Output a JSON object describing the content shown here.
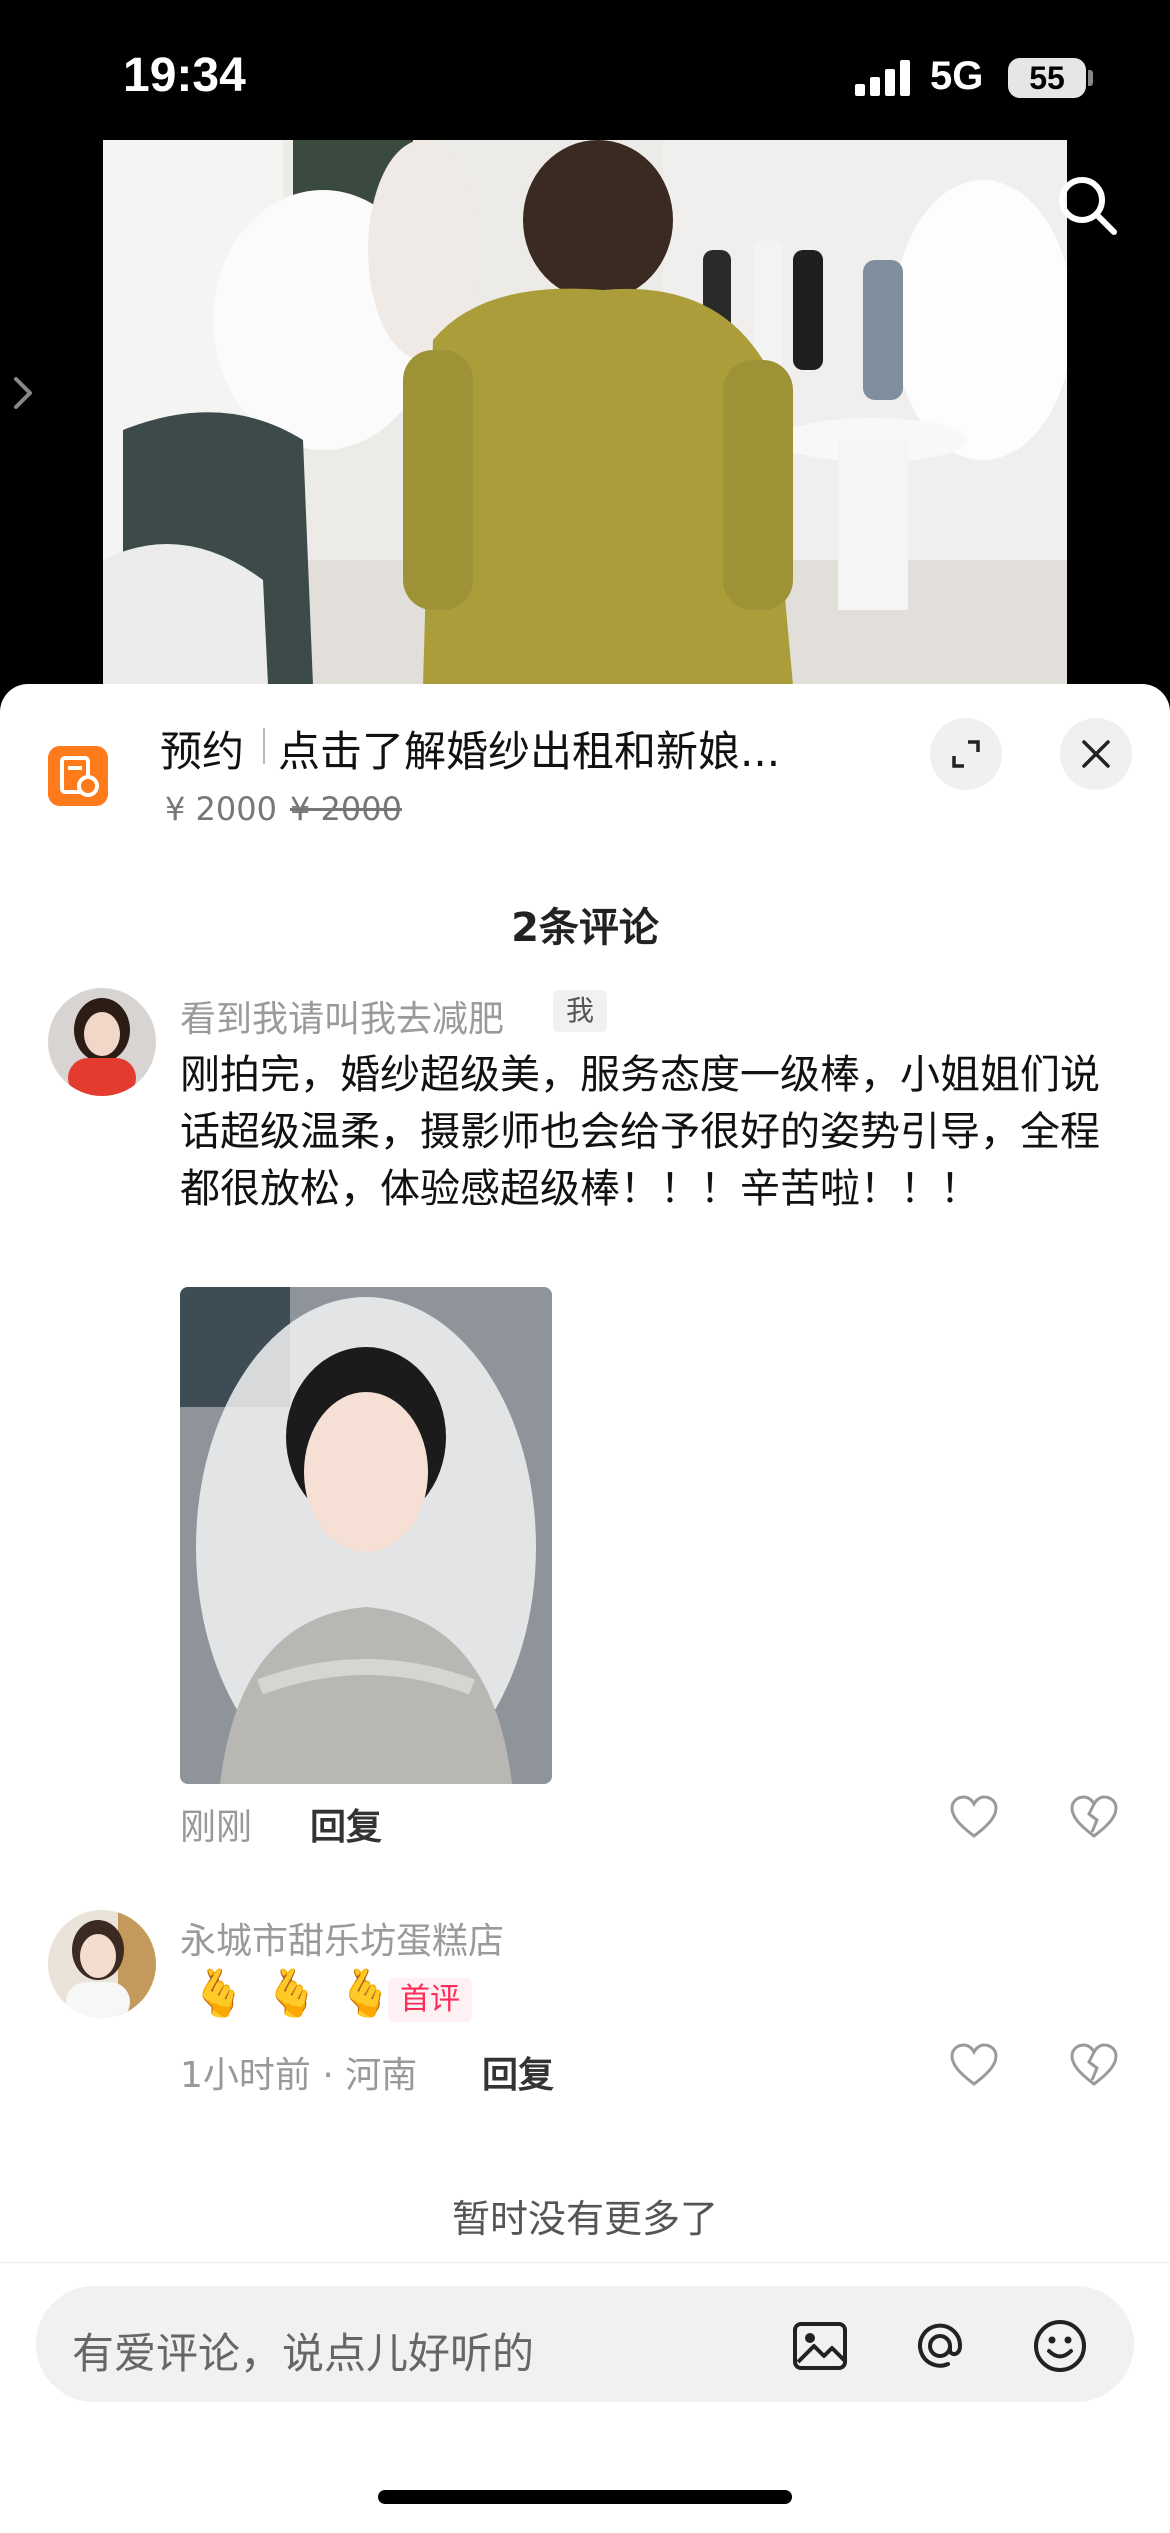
{
  "status_bar": {
    "time": "19:34",
    "network": "5G",
    "battery": "55"
  },
  "product": {
    "tag": "预约",
    "title": "点击了解婚纱出租和新娘...",
    "price": "¥ 2000",
    "original_price": "¥ 2000"
  },
  "comments_header": "2条评论",
  "comments": [
    {
      "username": "看到我请叫我去减肥",
      "badge": "我",
      "text": "刚拍完，婚纱超级美，服务态度一级棒，小姐姐们说话超级温柔，摄影师也会给予很好的姿势引导，全程都很放松，体验感超级棒！！！辛苦啦！！！",
      "time": "刚刚",
      "reply_label": "回复"
    },
    {
      "username": "永城市甜乐坊蛋糕店",
      "emojis": [
        "🫰",
        "🫰",
        "🫰"
      ],
      "first_badge": "首评",
      "time_location": "1小时前 · 河南",
      "reply_label": "回复"
    }
  ],
  "no_more": "暂时没有更多了",
  "input": {
    "placeholder": "有爱评论，说点儿好听的"
  },
  "icons": {
    "search": "search-icon",
    "expand": "expand-icon",
    "close": "close-icon",
    "like": "heart-icon",
    "dislike": "broken-heart-icon",
    "image": "image-icon",
    "mention": "at-icon",
    "emoji": "smiley-icon"
  },
  "colors": {
    "accent": "#ff2b58",
    "product_icon": "#ff7a1a"
  }
}
